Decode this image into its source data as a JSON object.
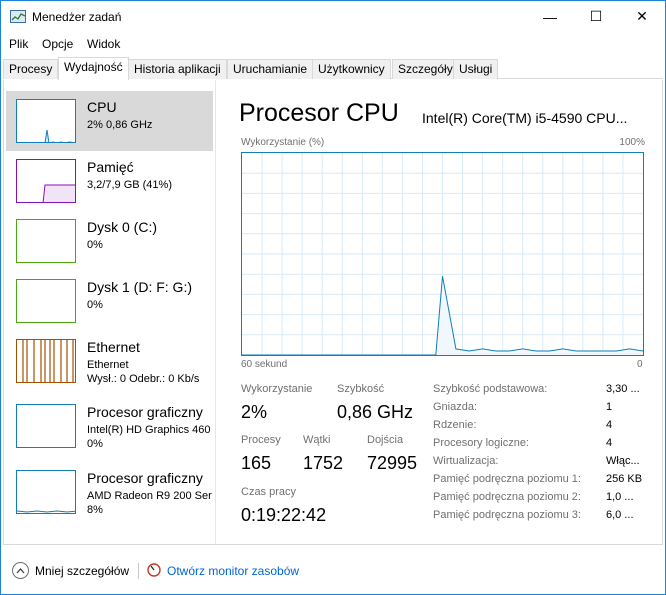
{
  "window": {
    "title": "Menedżer zadań",
    "controls": {
      "minimize": "—",
      "maximize": "☐",
      "close": "✕"
    }
  },
  "menu": [
    "Plik",
    "Opcje",
    "Widok"
  ],
  "tabs": [
    "Procesy",
    "Wydajność",
    "Historia aplikacji",
    "Uruchamianie",
    "Użytkownicy",
    "Szczegóły",
    "Usługi"
  ],
  "active_tab": "Wydajność",
  "sidebar": {
    "items": [
      {
        "name": "CPU",
        "line1": "2% 0,86 GHz",
        "line2": "",
        "color": "#117dbb"
      },
      {
        "name": "Pamięć",
        "line1": "3,2/7,9 GB (41%)",
        "line2": "",
        "color": "#8b12ae"
      },
      {
        "name": "Dysk 0 (C:)",
        "line1": "0%",
        "line2": "",
        "color": "#4da60c"
      },
      {
        "name": "Dysk 1 (D: F: G:)",
        "line1": "0%",
        "line2": "",
        "color": "#4da60c"
      },
      {
        "name": "Ethernet",
        "line1": "Ethernet",
        "line2": "Wysł.: 0 Odebr.: 0 Kb/s",
        "color": "#a74f01"
      },
      {
        "name": "Procesor graficzny",
        "line1": "Intel(R) HD Graphics 460",
        "line2": "0%",
        "color": "#117dbb"
      },
      {
        "name": "Procesor graficzny",
        "line1": "AMD Radeon R9 200 Ser",
        "line2": "8%",
        "color": "#117dbb"
      }
    ]
  },
  "main": {
    "title": "Procesor CPU",
    "model": "Intel(R) Core(TM) i5-4590 CPU...",
    "chart_top_left": "Wykorzystanie (%)",
    "chart_top_right": "100%",
    "axis_left": "60 sekund",
    "axis_right": "0",
    "stats": {
      "usage_label": "Wykorzystanie",
      "usage_value": "2%",
      "speed_label": "Szybkość",
      "speed_value": "0,86 GHz",
      "processes_label": "Procesy",
      "processes_value": "165",
      "threads_label": "Wątki",
      "threads_value": "1752",
      "handles_label": "Dojścia",
      "handles_value": "72995",
      "uptime_label": "Czas pracy",
      "uptime_value": "0:19:22:42"
    },
    "specs": [
      {
        "label": "Szybkość podstawowa:",
        "value": "3,30 ..."
      },
      {
        "label": "Gniazda:",
        "value": "1"
      },
      {
        "label": "Rdzenie:",
        "value": "4"
      },
      {
        "label": "Procesory logiczne:",
        "value": "4"
      },
      {
        "label": "Wirtualizacja:",
        "value": "Włąc..."
      },
      {
        "label": "Pamięć podręczna poziomu 1:",
        "value": "256 KB"
      },
      {
        "label": "Pamięć podręczna poziomu 2:",
        "value": "1,0 ..."
      },
      {
        "label": "Pamięć podręczna poziomu 3:",
        "value": "6,0 ..."
      }
    ]
  },
  "footer": {
    "fewer_details": "Mniej szczegółów",
    "open_monitor": "Otwórz monitor zasobów"
  },
  "chart_data": {
    "type": "line",
    "title": "",
    "xlabel": "",
    "ylabel": "",
    "xlim": [
      60,
      0
    ],
    "ylim": [
      0,
      100
    ],
    "series": [
      {
        "x": [
          60,
          57,
          54,
          51,
          48,
          45,
          42,
          39,
          36,
          33,
          31,
          30,
          28,
          26,
          24,
          22,
          20,
          18,
          16,
          14,
          12,
          10,
          8,
          6,
          4,
          2,
          0
        ],
        "y": [
          0,
          0,
          0,
          0,
          0,
          0,
          0,
          0,
          0,
          0,
          0,
          39,
          3,
          2,
          3,
          2,
          2,
          3,
          2,
          2,
          3,
          2,
          2,
          2,
          2,
          3,
          2
        ]
      }
    ],
    "grid": true
  }
}
